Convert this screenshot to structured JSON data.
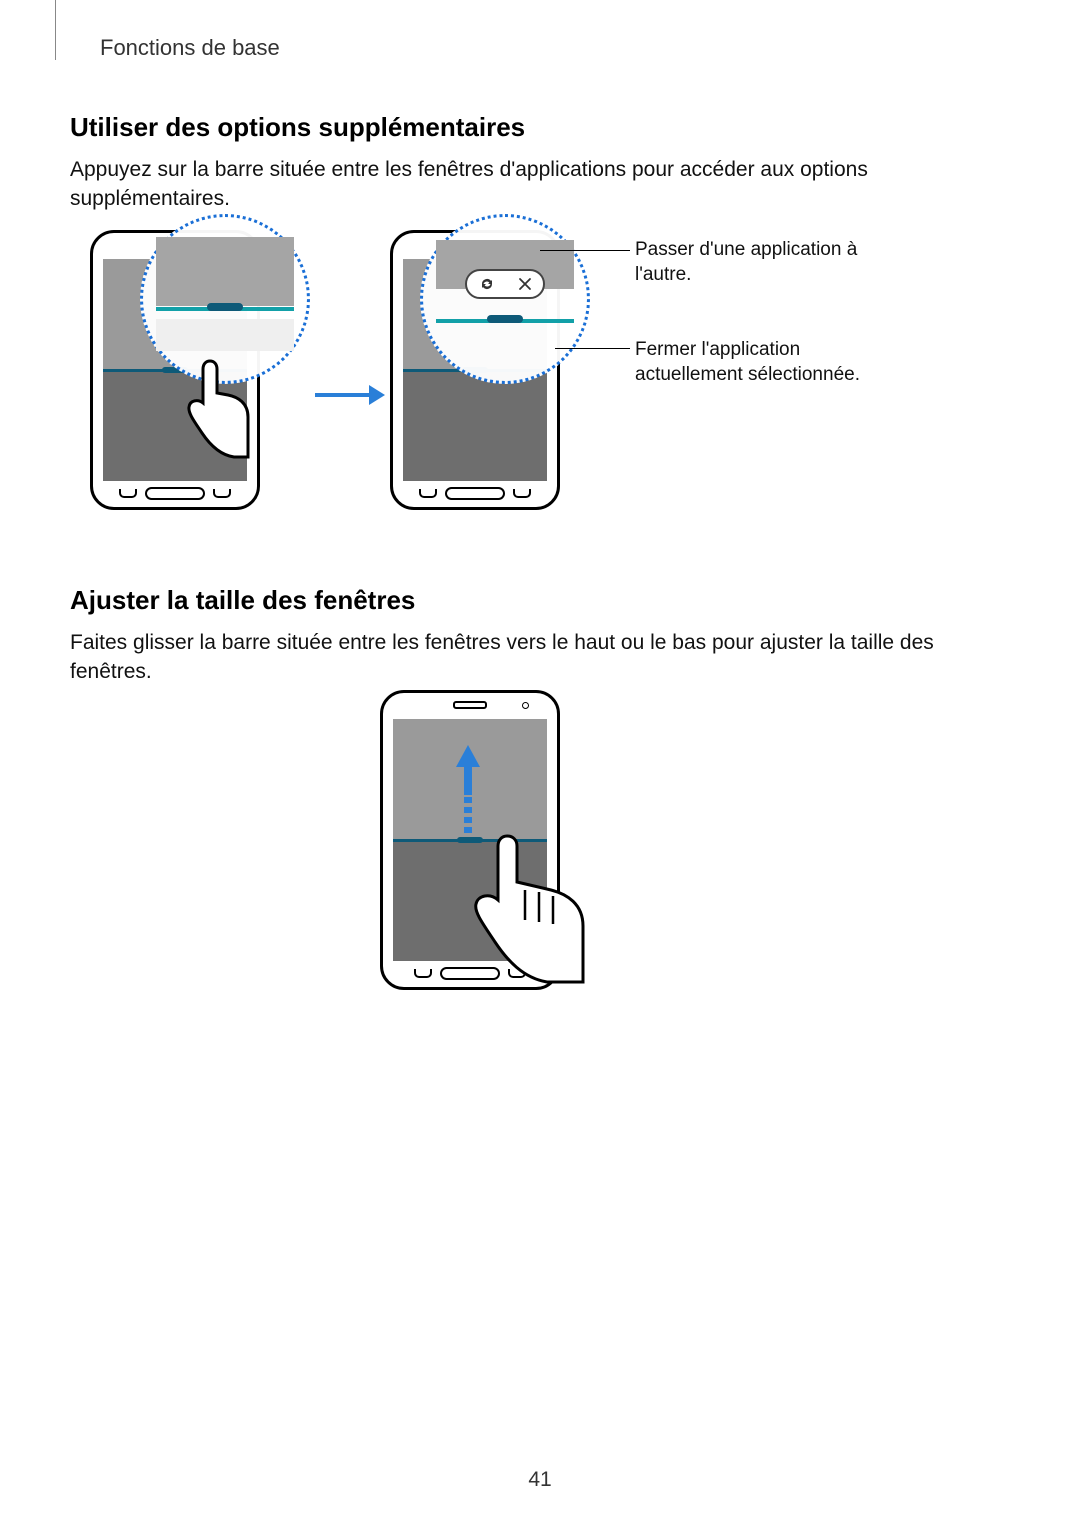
{
  "header": {
    "section_label": "Fonctions de base"
  },
  "section1": {
    "heading": "Utiliser des options supplémentaires",
    "body": "Appuyez sur la barre située entre les fenêtres d'applications pour accéder aux options supplémentaires."
  },
  "callouts": {
    "swap": "Passer d'une application à l'autre.",
    "close": "Fermer l'application actuellement sélectionnée."
  },
  "section2": {
    "heading": "Ajuster la taille des fenêtres",
    "body": "Faites glisser la barre située entre les fenêtres vers le haut ou le bas pour ajuster la taille des fenêtres."
  },
  "page_number": "41"
}
